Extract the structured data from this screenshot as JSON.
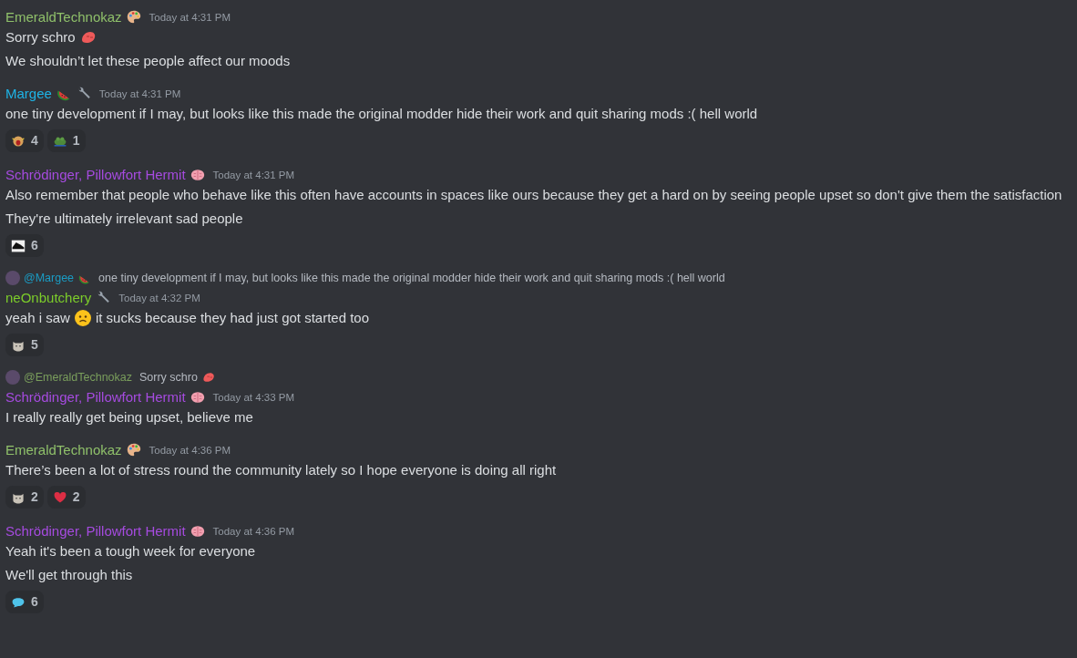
{
  "messages": [
    {
      "author": "EmeraldTechnokaz",
      "color": "#8fc06a",
      "badges": [
        {
          "kind": "palette"
        }
      ],
      "time": "Today at 4:31 PM",
      "lines": [
        [
          {
            "kind": "text",
            "text": "Sorry schro"
          },
          {
            "kind": "blob"
          }
        ],
        [
          {
            "kind": "text",
            "text": "We shouldn’t let these people affect our moods"
          }
        ]
      ]
    },
    {
      "author": "Margee",
      "color": "#1eb4e6",
      "badges": [
        {
          "kind": "watermelon"
        },
        {
          "kind": "wrench"
        }
      ],
      "time": "Today at 4:31 PM",
      "lines": [
        [
          {
            "kind": "text",
            "text": "one tiny development if I may, but looks like this made the original modder hide their work and quit sharing mods :( hell world"
          }
        ]
      ],
      "reactions": [
        {
          "kind": "angry",
          "count": "4"
        },
        {
          "kind": "frog",
          "count": "1"
        }
      ]
    },
    {
      "author": "Schrödinger,  Pillowfort Hermit",
      "color": "#a64be0",
      "badges": [
        {
          "kind": "brain"
        }
      ],
      "time": "Today at 4:31 PM",
      "lines": [
        [
          {
            "kind": "text",
            "text": "Also remember that people who behave like this often have accounts in spaces like ours because they get a hard on by seeing people upset so don't give them the satisfaction"
          }
        ],
        [
          {
            "kind": "text",
            "text": "They're ultimately irrelevant sad people"
          }
        ]
      ],
      "reactions": [
        {
          "kind": "sticker",
          "count": "6"
        }
      ]
    },
    {
      "reply": {
        "author": "@Margee",
        "color": "#1a9cc4",
        "badges": [
          {
            "kind": "watermelon"
          }
        ],
        "text": "one tiny development if I may, but looks like this made the original modder hide their work and quit sharing mods :( hell world"
      },
      "author": "neOnbutchery",
      "color": "#7ccc2a",
      "badges": [
        {
          "kind": "wrench"
        }
      ],
      "time": "Today at 4:32 PM",
      "lines": [
        [
          {
            "kind": "text",
            "text": "yeah i saw"
          },
          {
            "kind": "sad"
          },
          {
            "kind": "text",
            "text": "it sucks because they had just got started too"
          }
        ]
      ],
      "reactions": [
        {
          "kind": "cat",
          "count": "5"
        }
      ]
    },
    {
      "reply": {
        "author": "@EmeraldTechnokaz",
        "color": "#7a9e5c",
        "text": "Sorry schro",
        "emoji": {
          "kind": "blob"
        }
      },
      "author": "Schrödinger,  Pillowfort Hermit",
      "color": "#a64be0",
      "badges": [
        {
          "kind": "brain"
        }
      ],
      "time": "Today at 4:33 PM",
      "lines": [
        [
          {
            "kind": "text",
            "text": "I really really get being upset, believe me"
          }
        ]
      ]
    },
    {
      "author": "EmeraldTechnokaz",
      "color": "#8fc06a",
      "badges": [
        {
          "kind": "palette"
        }
      ],
      "time": "Today at 4:36 PM",
      "lines": [
        [
          {
            "kind": "text",
            "text": "There’s been a lot of stress round the community lately so I hope everyone is doing all right"
          }
        ]
      ],
      "reactions": [
        {
          "kind": "cat",
          "count": "2"
        },
        {
          "kind": "heart",
          "count": "2"
        }
      ]
    },
    {
      "author": "Schrödinger,  Pillowfort Hermit",
      "color": "#a64be0",
      "badges": [
        {
          "kind": "brain"
        }
      ],
      "time": "Today at 4:36 PM",
      "lines": [
        [
          {
            "kind": "text",
            "text": "Yeah it's been a tough week for everyone"
          }
        ],
        [
          {
            "kind": "text",
            "text": "We'll get through this"
          }
        ]
      ],
      "reactions": [
        {
          "kind": "bubble",
          "count": "6"
        }
      ]
    }
  ]
}
